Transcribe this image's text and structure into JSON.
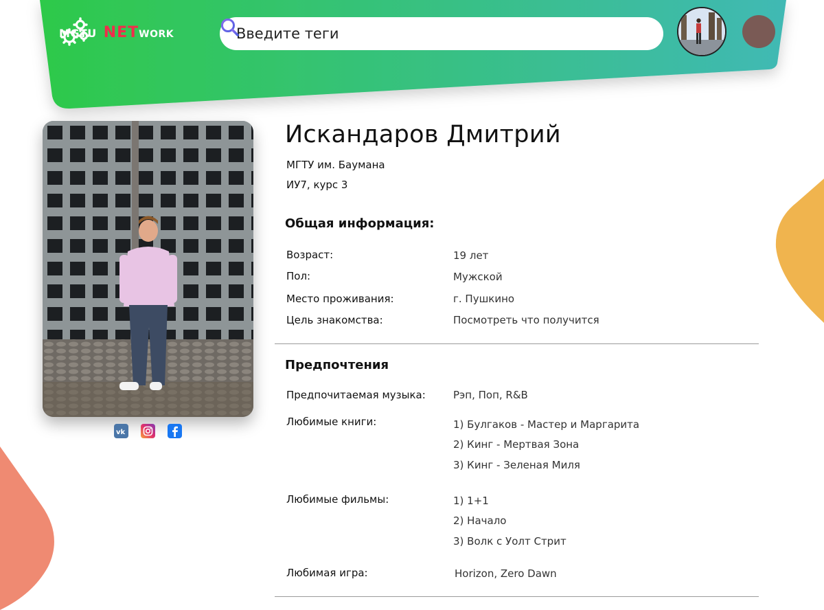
{
  "header": {
    "logo": {
      "mgtu": "MGTU",
      "net": "NET",
      "work": "WORK"
    },
    "search": {
      "placeholder": "Введите теги"
    }
  },
  "profile": {
    "name": "Искандаров Дмитрий",
    "university": "МГТУ им. Баумана",
    "group": "ИУ7, курс 3",
    "socials": [
      "vk-icon",
      "instagram-icon",
      "facebook-icon"
    ]
  },
  "general": {
    "title": "Общая информация:",
    "rows": [
      {
        "label": "Возраст:",
        "value": "19 лет"
      },
      {
        "label": "Пол:",
        "value": "Мужской"
      },
      {
        "label": "Место проживания:",
        "value": "г. Пушкино"
      },
      {
        "label": "Цель знакомства:",
        "value": "Посмотреть что получится"
      }
    ]
  },
  "preferences": {
    "title": "Предпочтения",
    "music": {
      "label": "Предпочитаемая музыка:",
      "value": "Рэп, Поп, R&B"
    },
    "books": {
      "label": "Любимые книги:",
      "items": [
        "1) Булгаков - Мастер и Маргарита",
        "2) Кинг - Мертвая Зона",
        "3) Кинг - Зеленая Миля"
      ]
    },
    "films": {
      "label": "Любимые фильмы:",
      "items": [
        "1) 1+1",
        "2) Начало",
        "3) Волк с Уолт Стрит"
      ]
    },
    "game": {
      "label": "Любимая игра:",
      "value": "Horizon, Zero Dawn"
    }
  },
  "colors": {
    "header_gradient_start": "#2ec94a",
    "header_gradient_end": "#40b9b4",
    "net_red": "#f02d4b",
    "menu_dot": "#7a5a55",
    "blob_orange": "#f0b44e",
    "blob_salmon": "#ef8a72"
  }
}
